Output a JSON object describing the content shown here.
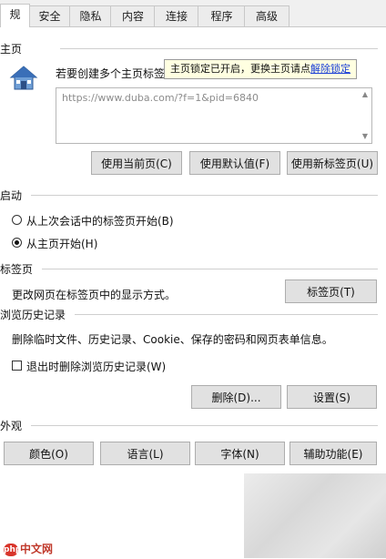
{
  "tabs": [
    "规",
    "安全",
    "隐私",
    "内容",
    "连接",
    "程序",
    "高级"
  ],
  "home": {
    "section_title": "主页",
    "description": "若要创建多个主页标签",
    "url": "https://www.duba.com/?f=1&pid=6840",
    "tooltip_text": "主页锁定已开启，更换主页请点",
    "tooltip_link": "解除锁定",
    "btn_current": "使用当前页(C)",
    "btn_default": "使用默认值(F)",
    "btn_newtab": "使用新标签页(U)"
  },
  "startup": {
    "section_title": "启动",
    "option_last_session": "从上次会话中的标签页开始(B)",
    "option_home": "从主页开始(H)",
    "selected": "option_home"
  },
  "tabs_section": {
    "section_title": "标签页",
    "description": "更改网页在标签页中的显示方式。",
    "btn_tabs": "标签页(T)"
  },
  "history": {
    "section_title": "浏览历史记录",
    "description": "删除临时文件、历史记录、Cookie、保存的密码和网页表单信息。",
    "checkbox_label": "退出时删除浏览历史记录(W)",
    "checkbox_checked": false,
    "btn_delete": "删除(D)...",
    "btn_settings": "设置(S)"
  },
  "appearance": {
    "section_title": "外观",
    "btn_colors": "颜色(O)",
    "btn_languages": "语言(L)",
    "btn_fonts": "字体(N)",
    "btn_accessibility": "辅助功能(E)"
  },
  "watermark": {
    "badge": "php",
    "text": "中文网"
  }
}
